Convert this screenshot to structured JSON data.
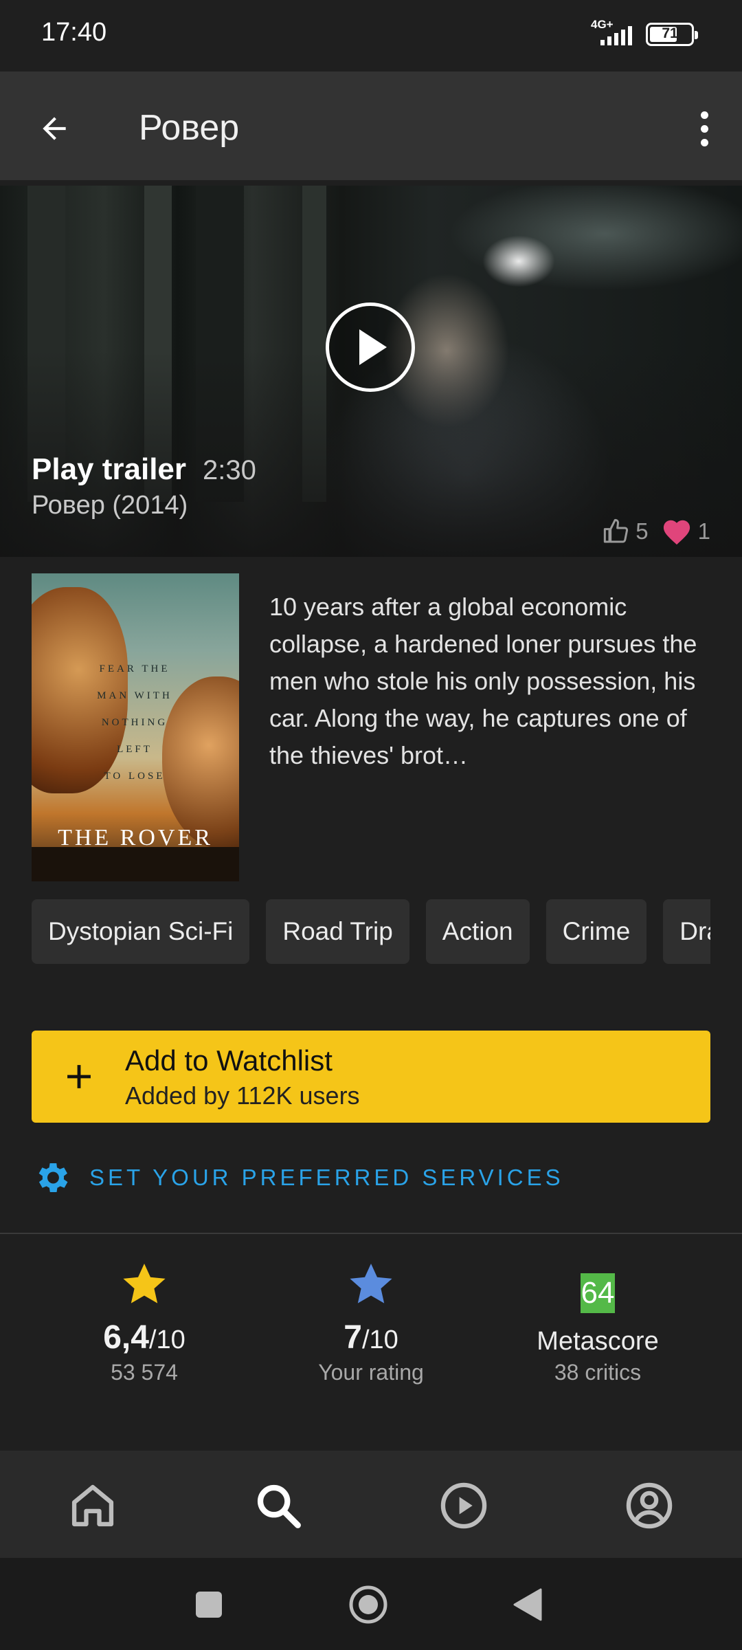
{
  "status_bar": {
    "time": "17:40",
    "network": "4G+",
    "battery": "71",
    "battery_level": 0.71
  },
  "app_bar": {
    "back_icon": "arrow-left-icon",
    "title": "Ровер",
    "menu_icon": "more-vertical-icon"
  },
  "trailer": {
    "play_icon": "play-icon",
    "label": "Play trailer",
    "duration": "2:30",
    "subtitle": "Ровер (2014)",
    "likes": "5",
    "hearts": "1"
  },
  "poster": {
    "tagline": [
      "FEAR THE",
      "MAN WITH",
      "NOTHING",
      "LEFT",
      "TO LOSE"
    ],
    "title": "THE ROVER"
  },
  "synopsis": "10 years after a global economic collapse, a hardened loner pursues the men who stole his only possession, his car. Along the way, he captures one of the thieves' brot…",
  "genres": [
    "Dystopian Sci-Fi",
    "Road Trip",
    "Action",
    "Crime",
    "Drama"
  ],
  "watchlist": {
    "title": "Add to Watchlist",
    "subtitle": "Added by 112K users"
  },
  "services": {
    "label": "SET YOUR PREFERRED SERVICES"
  },
  "ratings": {
    "imdb": {
      "value": "6,4",
      "scale": "/10",
      "count": "53 574"
    },
    "user": {
      "value": "7",
      "scale": "/10",
      "label": "Your rating"
    },
    "metascore": {
      "score": "64",
      "label": "Metascore",
      "critics": "38 critics"
    }
  },
  "colors": {
    "accent_yellow": "#f5c518",
    "link_blue": "#2aa3e8",
    "user_star_blue": "#5b8cde",
    "metascore_green": "#54b948",
    "heart_pink": "#e0457b"
  },
  "bottom_nav": [
    "home-icon",
    "search-icon",
    "play-circle-icon",
    "account-icon"
  ],
  "system_nav": [
    "recents-square-icon",
    "home-circle-icon",
    "back-triangle-icon"
  ]
}
